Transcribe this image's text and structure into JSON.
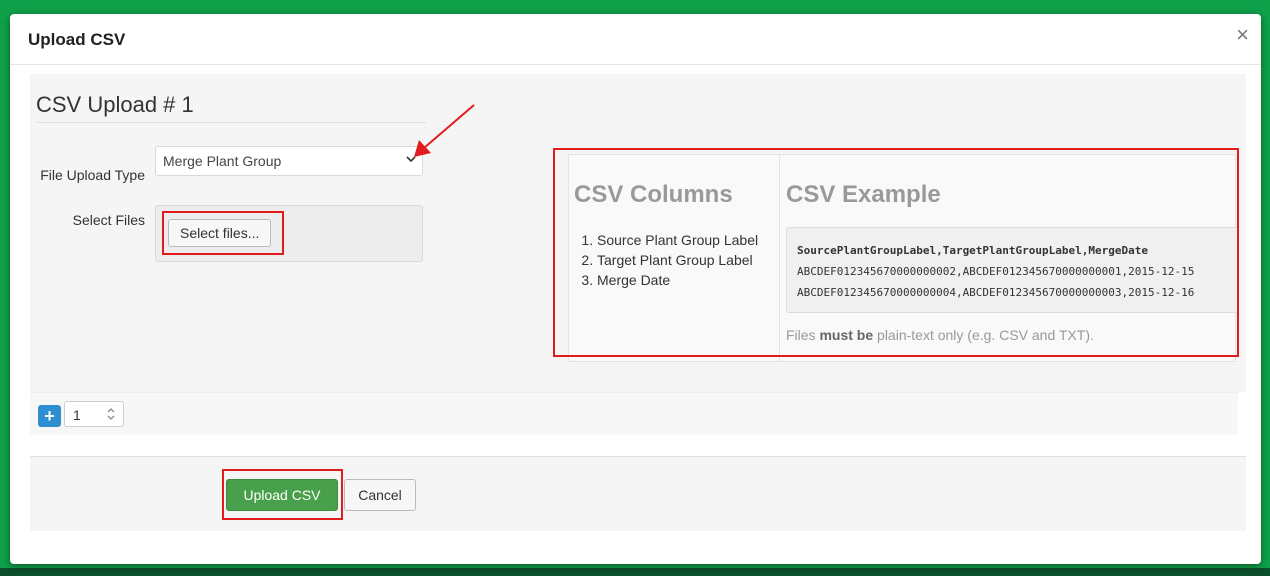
{
  "modal": {
    "title": "Upload CSV",
    "close_label": "×"
  },
  "form": {
    "heading": "CSV Upload # 1",
    "file_type_label": "File Upload Type",
    "file_type_value": "Merge Plant Group",
    "select_files_label": "Select Files",
    "select_files_button": "Select files..."
  },
  "info": {
    "columns_heading": "CSV Columns",
    "columns": [
      "Source Plant Group Label",
      "Target Plant Group Label",
      "Merge Date"
    ],
    "example_heading": "CSV Example",
    "example_header": "SourcePlantGroupLabel,TargetPlantGroupLabel,MergeDate",
    "example_rows": [
      "ABCDEF012345670000000002,ABCDEF012345670000000001,2015-12-15",
      "ABCDEF012345670000000004,ABCDEF012345670000000003,2015-12-16"
    ],
    "note_prefix": "Files ",
    "note_bold": "must be",
    "note_suffix": " plain-text only (e.g. CSV and TXT)."
  },
  "controls": {
    "add_label": "+",
    "count_value": "1"
  },
  "footer": {
    "upload_label": "Upload CSV",
    "cancel_label": "Cancel"
  },
  "colors": {
    "highlight": "#e21c1c",
    "primary_green": "#49a04a",
    "add_blue": "#2f8ed0",
    "background_green": "#0fa14a"
  }
}
